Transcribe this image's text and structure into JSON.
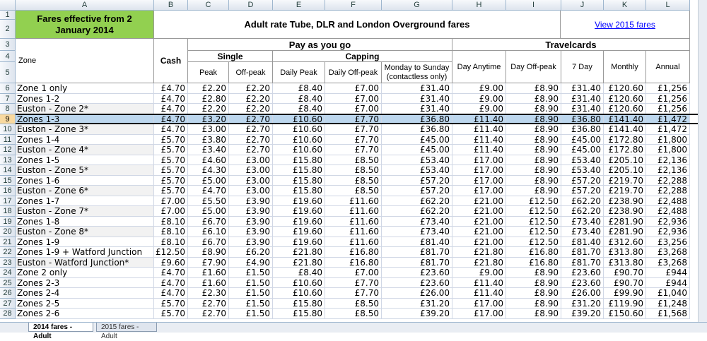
{
  "columns": [
    "A",
    "B",
    "C",
    "D",
    "E",
    "F",
    "G",
    "H",
    "I",
    "J",
    "K",
    "L"
  ],
  "title_cell": "Fares effective from 2 January 2014",
  "main_title": "Adult rate Tube, DLR and London Overground fares",
  "link_text": "View 2015 fares",
  "headers": {
    "zone": "Zone",
    "cash": "Cash",
    "payg": "Pay as you go",
    "single": "Single",
    "capping": "Capping",
    "travelcards": "Travelcards",
    "peak": "Peak",
    "offpeak": "Off-peak",
    "daily_peak": "Daily Peak",
    "daily_offpeak": "Daily Off-peak",
    "mon_sun": "Monday to Sunday (contactless only)",
    "day_anytime": "Day Anytime",
    "day_offpeak": "Day Off-peak",
    "seven_day": "7 Day",
    "monthly": "Monthly",
    "annual": "Annual"
  },
  "rows": [
    {
      "n": "6",
      "cells": [
        "Zone 1 only",
        "£4.70",
        "£2.20",
        "£2.20",
        "£8.40",
        "£7.00",
        "£31.40",
        "£9.00",
        "£8.90",
        "£31.40",
        "£120.60",
        "£1,256"
      ]
    },
    {
      "n": "7",
      "cells": [
        "Zones 1-2",
        "£4.70",
        "£2.80",
        "£2.20",
        "£8.40",
        "£7.00",
        "£31.40",
        "£9.00",
        "£8.90",
        "£31.40",
        "£120.60",
        "£1,256"
      ]
    },
    {
      "n": "8",
      "cells": [
        "Euston - Zone 2*",
        "£4.70",
        "£2.20",
        "£2.20",
        "£8.40",
        "£7.00",
        "£31.40",
        "£9.00",
        "£8.90",
        "£31.40",
        "£120.60",
        "£1,256"
      ]
    },
    {
      "n": "9",
      "cells": [
        "Zones 1-3",
        "£4.70",
        "£3.20",
        "£2.70",
        "£10.60",
        "£7.70",
        "£36.80",
        "£11.40",
        "£8.90",
        "£36.80",
        "£141.40",
        "£1,472"
      ]
    },
    {
      "n": "10",
      "cells": [
        "Euston - Zone 3*",
        "£4.70",
        "£3.00",
        "£2.70",
        "£10.60",
        "£7.70",
        "£36.80",
        "£11.40",
        "£8.90",
        "£36.80",
        "£141.40",
        "£1,472"
      ]
    },
    {
      "n": "11",
      "cells": [
        "Zones 1-4",
        "£5.70",
        "£3.80",
        "£2.70",
        "£10.60",
        "£7.70",
        "£45.00",
        "£11.40",
        "£8.90",
        "£45.00",
        "£172.80",
        "£1,800"
      ]
    },
    {
      "n": "12",
      "cells": [
        "Euston - Zone 4*",
        "£5.70",
        "£3.40",
        "£2.70",
        "£10.60",
        "£7.70",
        "£45.00",
        "£11.40",
        "£8.90",
        "£45.00",
        "£172.80",
        "£1,800"
      ]
    },
    {
      "n": "13",
      "cells": [
        "Zones 1-5",
        "£5.70",
        "£4.60",
        "£3.00",
        "£15.80",
        "£8.50",
        "£53.40",
        "£17.00",
        "£8.90",
        "£53.40",
        "£205.10",
        "£2,136"
      ]
    },
    {
      "n": "14",
      "cells": [
        "Euston - Zone 5*",
        "£5.70",
        "£4.30",
        "£3.00",
        "£15.80",
        "£8.50",
        "£53.40",
        "£17.00",
        "£8.90",
        "£53.40",
        "£205.10",
        "£2,136"
      ]
    },
    {
      "n": "15",
      "cells": [
        "Zones 1-6",
        "£5.70",
        "£5.00",
        "£3.00",
        "£15.80",
        "£8.50",
        "£57.20",
        "£17.00",
        "£8.90",
        "£57.20",
        "£219.70",
        "£2,288"
      ]
    },
    {
      "n": "16",
      "cells": [
        "Euston - Zone 6*",
        "£5.70",
        "£4.70",
        "£3.00",
        "£15.80",
        "£8.50",
        "£57.20",
        "£17.00",
        "£8.90",
        "£57.20",
        "£219.70",
        "£2,288"
      ]
    },
    {
      "n": "17",
      "cells": [
        "Zones 1-7",
        "£7.00",
        "£5.50",
        "£3.90",
        "£19.60",
        "£11.60",
        "£62.20",
        "£21.00",
        "£12.50",
        "£62.20",
        "£238.90",
        "£2,488"
      ]
    },
    {
      "n": "18",
      "cells": [
        "Euston - Zone 7*",
        "£7.00",
        "£5.00",
        "£3.90",
        "£19.60",
        "£11.60",
        "£62.20",
        "£21.00",
        "£12.50",
        "£62.20",
        "£238.90",
        "£2,488"
      ]
    },
    {
      "n": "19",
      "cells": [
        "Zones 1-8",
        "£8.10",
        "£6.70",
        "£3.90",
        "£19.60",
        "£11.60",
        "£73.40",
        "£21.00",
        "£12.50",
        "£73.40",
        "£281.90",
        "£2,936"
      ]
    },
    {
      "n": "20",
      "cells": [
        "Euston - Zone 8*",
        "£8.10",
        "£6.10",
        "£3.90",
        "£19.60",
        "£11.60",
        "£73.40",
        "£21.00",
        "£12.50",
        "£73.40",
        "£281.90",
        "£2,936"
      ]
    },
    {
      "n": "21",
      "cells": [
        "Zones 1-9",
        "£8.10",
        "£6.70",
        "£3.90",
        "£19.60",
        "£11.60",
        "£81.40",
        "£21.00",
        "£12.50",
        "£81.40",
        "£312.60",
        "£3,256"
      ]
    },
    {
      "n": "22",
      "cells": [
        "Zones 1-9 + Watford Junction",
        "£12.50",
        "£8.90",
        "£6.20",
        "£21.80",
        "£16.80",
        "£81.70",
        "£21.80",
        "£16.80",
        "£81.70",
        "£313.80",
        "£3,268"
      ]
    },
    {
      "n": "23",
      "cells": [
        "Euston - Watford Junction*",
        "£9.60",
        "£7.90",
        "£4.90",
        "£21.80",
        "£16.80",
        "£81.70",
        "£21.80",
        "£16.80",
        "£81.70",
        "£313.80",
        "£3,268"
      ]
    },
    {
      "n": "24",
      "cells": [
        "Zone 2 only",
        "£4.70",
        "£1.60",
        "£1.50",
        "£8.40",
        "£7.00",
        "£23.60",
        "£9.00",
        "£8.90",
        "£23.60",
        "£90.70",
        "£944"
      ]
    },
    {
      "n": "25",
      "cells": [
        "Zones 2-3",
        "£4.70",
        "£1.60",
        "£1.50",
        "£10.60",
        "£7.70",
        "£23.60",
        "£11.40",
        "£8.90",
        "£23.60",
        "£90.70",
        "£944"
      ]
    },
    {
      "n": "26",
      "cells": [
        "Zones 2-4",
        "£4.70",
        "£2.30",
        "£1.50",
        "£10.60",
        "£7.70",
        "£26.00",
        "£11.40",
        "£8.90",
        "£26.00",
        "£99.90",
        "£1,040"
      ]
    },
    {
      "n": "27",
      "cells": [
        "Zones 2-5",
        "£5.70",
        "£2.70",
        "£1.50",
        "£15.80",
        "£8.50",
        "£31.20",
        "£17.00",
        "£8.90",
        "£31.20",
        "£119.90",
        "£1,248"
      ]
    },
    {
      "n": "28",
      "cells": [
        "Zones 2-6",
        "£5.70",
        "£2.70",
        "£1.50",
        "£15.80",
        "£8.50",
        "£39.20",
        "£17.00",
        "£8.90",
        "£39.20",
        "£150.60",
        "£1,568"
      ]
    }
  ],
  "header_row_numbers": [
    "1",
    "2",
    "3",
    "4",
    "5"
  ],
  "selected_row": "9",
  "tabs": [
    "2014 fares - Adult",
    "2015 fares - Adult"
  ],
  "colors": {
    "title_fill": "#92d050",
    "selection": "#bdd7ee",
    "link": "#0000ff"
  }
}
